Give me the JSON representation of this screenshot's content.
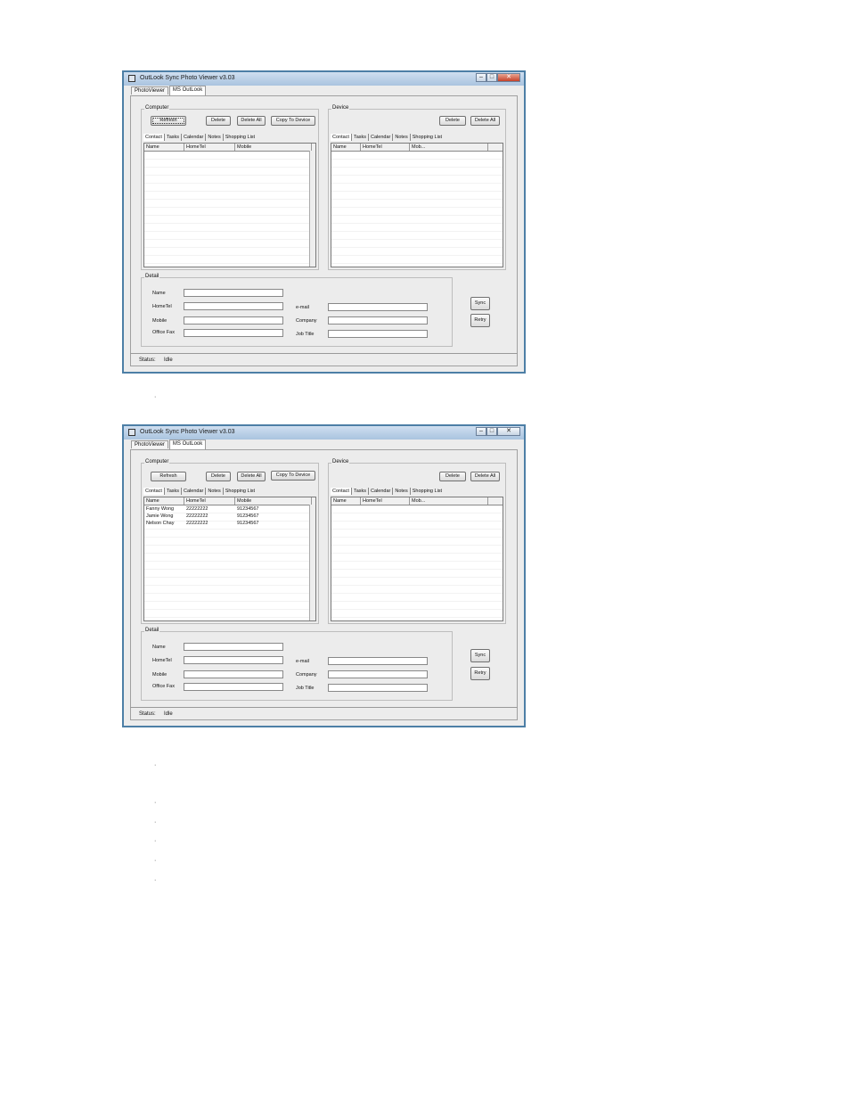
{
  "window": {
    "title": "OutLook Sync Photo Viewer v3.03",
    "min_glyph": "–",
    "max_glyph": "□",
    "close_glyph": "✕"
  },
  "main_tabs": [
    "PhotoViewer",
    "MS OutLook"
  ],
  "computer": {
    "label": "Computer",
    "refresh": "Refresh",
    "delete": "Delete",
    "delete_all": "Delete All",
    "copy_to_device": "Copy To Device",
    "tabs": [
      "Contact",
      "Tasks",
      "Calendar",
      "Notes",
      "Shopping List"
    ],
    "columns": [
      "Name",
      "HomeTel",
      "Mobile"
    ]
  },
  "device": {
    "label": "Device",
    "delete": "Delete",
    "delete_all": "Delete All",
    "tabs": [
      "Contact",
      "Tasks",
      "Calendar",
      "Notes",
      "Shopping List"
    ],
    "columns": [
      "Name",
      "HomeTel",
      "Mob..."
    ]
  },
  "detail": {
    "label": "Detail",
    "name": "Name",
    "hometel": "HomeTel",
    "mobile": "Mobile",
    "office_fax": "Office Fax",
    "email": "e-mail",
    "company": "Company",
    "job_title": "Job Title"
  },
  "sync": "Sync",
  "retry": "Retry",
  "status": {
    "label": "Status:",
    "value": "Idle"
  },
  "contacts_second": [
    [
      "Fanny Wong",
      "22222222",
      "91234567"
    ],
    [
      "Jamie Wong",
      "22222222",
      "91234567"
    ],
    [
      "Nelson Chay",
      "22222222",
      "91234567"
    ]
  ],
  "bullet": "·"
}
